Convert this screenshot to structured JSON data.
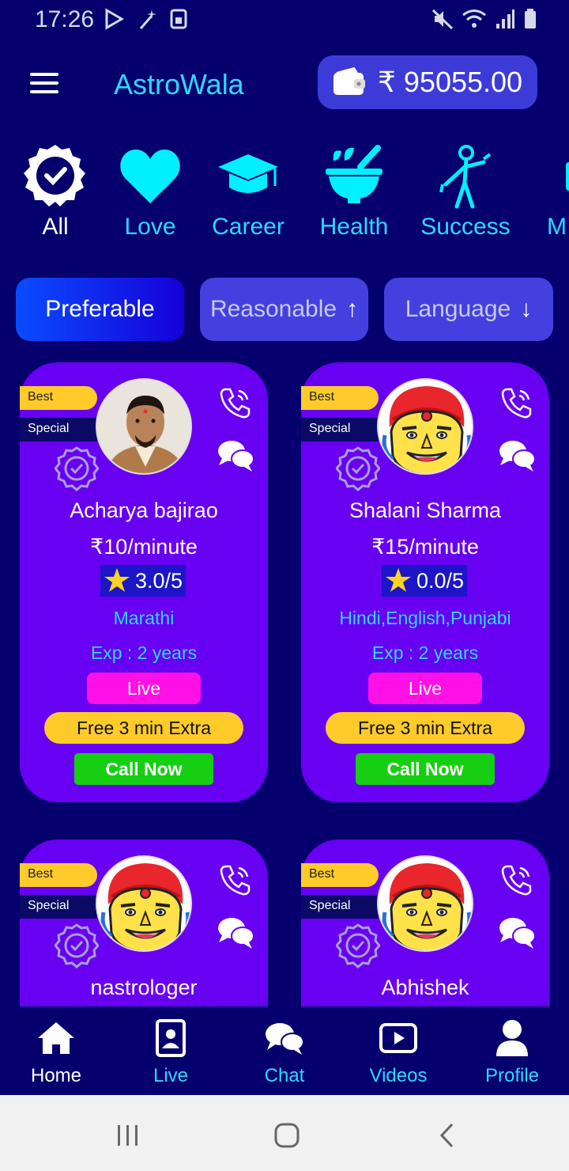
{
  "status_bar": {
    "time": "17:26"
  },
  "header": {
    "app_name": "AstroWala",
    "wallet_amount": "₹ 95055.00"
  },
  "categories": [
    {
      "label": "All",
      "icon": "check-badge-icon"
    },
    {
      "label": "Love",
      "icon": "heart-icon"
    },
    {
      "label": "Career",
      "icon": "graduation-cap-icon"
    },
    {
      "label": "Health",
      "icon": "mortar-pestle-icon"
    },
    {
      "label": "Success",
      "icon": "success-figure-icon"
    },
    {
      "label": "M",
      "icon": "partial-icon"
    }
  ],
  "filters": [
    {
      "label": "Preferable"
    },
    {
      "label": "Reasonable",
      "arrow": "↑"
    },
    {
      "label": "Language",
      "arrow": "↓"
    }
  ],
  "astrologers": [
    {
      "badge_best": "Best",
      "badge_special": "Special",
      "name": "Acharya bajirao",
      "price": "₹10/minute",
      "rating": "3.0/5",
      "language": "Marathi",
      "experience": "Exp : 2 years",
      "status": "Live",
      "offer": "Free 3 min Extra",
      "cta": "Call Now",
      "avatar": "photo"
    },
    {
      "badge_best": "Best",
      "badge_special": "Special",
      "name": "Shalani Sharma",
      "price": "₹15/minute",
      "rating": "0.0/5",
      "language": "Hindi,English,Punjabi",
      "experience": "Exp : 2 years",
      "status": "Live",
      "offer": "Free 3 min Extra",
      "cta": "Call Now",
      "avatar": "cartoon"
    },
    {
      "badge_best": "Best",
      "badge_special": "Special",
      "name": "nastrologer",
      "avatar": "cartoon"
    },
    {
      "badge_best": "Best",
      "badge_special": "Special",
      "name": "Abhishek",
      "avatar": "cartoon"
    }
  ],
  "bottom_nav": [
    {
      "label": "Home",
      "icon": "home-icon",
      "active": true
    },
    {
      "label": "Live",
      "icon": "live-icon"
    },
    {
      "label": "Chat",
      "icon": "chat-icon"
    },
    {
      "label": "Videos",
      "icon": "video-icon"
    },
    {
      "label": "Profile",
      "icon": "profile-icon"
    }
  ],
  "colors": {
    "background": "#05006e",
    "card": "#6800f2",
    "accent": "#2fd8ff",
    "live": "#ff10e6",
    "offer": "#ffcb2b",
    "call": "#17cf12"
  }
}
